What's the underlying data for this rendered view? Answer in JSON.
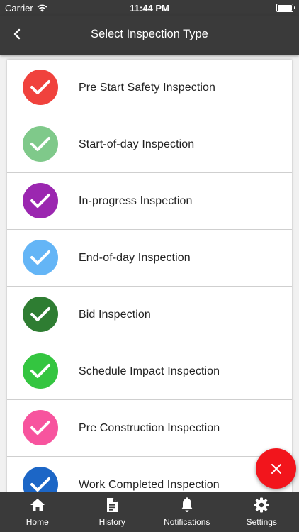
{
  "status_bar": {
    "carrier": "Carrier",
    "time": "11:44 PM"
  },
  "nav": {
    "title": "Select Inspection Type",
    "back_icon": "chevron-left-icon"
  },
  "inspections": [
    {
      "label": "Pre Start Safety Inspection",
      "color": "#f0423d"
    },
    {
      "label": "Start-of-day Inspection",
      "color": "#7fc98a"
    },
    {
      "label": "In-progress Inspection",
      "color": "#9b27b0"
    },
    {
      "label": "End-of-day Inspection",
      "color": "#64b5f6"
    },
    {
      "label": "Bid Inspection",
      "color": "#2e7d32"
    },
    {
      "label": "Schedule Impact Inspection",
      "color": "#34c540"
    },
    {
      "label": "Pre Construction Inspection",
      "color": "#f7549e"
    },
    {
      "label": "Work Completed Inspection",
      "color": "#1c66c6"
    }
  ],
  "fab": {
    "icon": "close-icon",
    "color": "#f2151c"
  },
  "tabs": [
    {
      "label": "Home",
      "icon": "home-icon"
    },
    {
      "label": "History",
      "icon": "document-icon"
    },
    {
      "label": "Notifications",
      "icon": "bell-icon"
    },
    {
      "label": "Settings",
      "icon": "gear-icon"
    }
  ]
}
